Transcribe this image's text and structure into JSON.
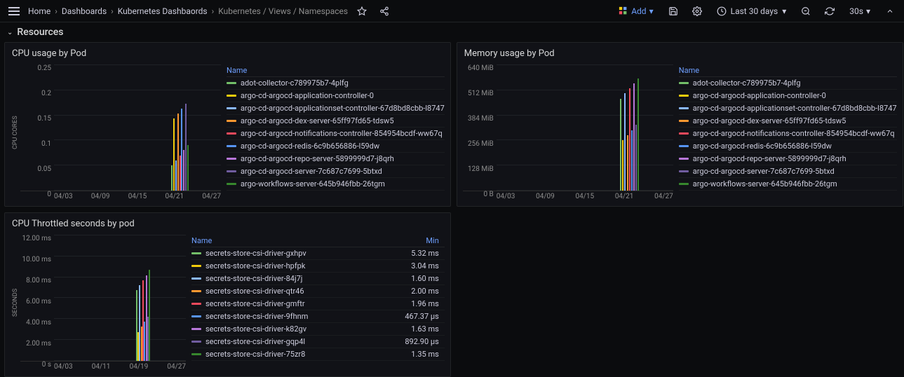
{
  "topbar": {
    "breadcrumbs": [
      "Home",
      "Dashboards",
      "Kubernetes Dashbaords",
      "Kubernetes / Views / Namespaces"
    ],
    "add_label": "Add",
    "range_label": "Last 30 days",
    "refresh_interval": "30s"
  },
  "section": {
    "title": "Resources"
  },
  "legend_labels": {
    "name": "Name",
    "min": "Min"
  },
  "colors": {
    "series": [
      "#73bf69",
      "#f2cc0c",
      "#8ab8ff",
      "#ff9830",
      "#f2495c",
      "#5794f2",
      "#b877d9",
      "#705da0",
      "#37872d",
      "#c15c17",
      "#890f02",
      "#0a437c",
      "#6d1f62",
      "#e0b400",
      "#1f78c1",
      "#ba43a9",
      "#705da0"
    ]
  },
  "panels": [
    {
      "id": "cpu-usage",
      "title": "CPU usage by Pod",
      "ylabel": "CPU CORES",
      "has_min": false,
      "chart_data": {
        "type": "line",
        "x_categories": [
          "04/03",
          "04/09",
          "04/15",
          "04/21",
          "04/27"
        ],
        "y_ticks": [
          "0",
          "0.05",
          "0.1",
          "0.15",
          "0.2",
          "0.25"
        ],
        "ylim": [
          0,
          0.27
        ],
        "spike_region": {
          "x_pct_start": 70,
          "x_pct_end": 80
        },
        "series": [
          {
            "name": "adot-collector-c789975b7-4plfg"
          },
          {
            "name": "argo-cd-argocd-application-controller-0"
          },
          {
            "name": "argo-cd-argocd-applicationset-controller-67d8bd8cbb-l8747"
          },
          {
            "name": "argo-cd-argocd-dex-server-65ff97fd65-tdsw5"
          },
          {
            "name": "argo-cd-argocd-notifications-controller-854954bcdf-ww67q"
          },
          {
            "name": "argo-cd-argocd-redis-6c9b656886-l59dw"
          },
          {
            "name": "argo-cd-argocd-repo-server-5899999d7-j8qrh"
          },
          {
            "name": "argo-cd-argocd-server-7c687c7699-5btxd"
          },
          {
            "name": "argo-workflows-server-645b946fbb-26tgm"
          }
        ]
      }
    },
    {
      "id": "memory-usage",
      "title": "Memory usage by Pod",
      "ylabel": "",
      "has_min": false,
      "chart_data": {
        "type": "line",
        "x_categories": [
          "04/03",
          "04/09",
          "04/15",
          "04/21",
          "04/27"
        ],
        "y_ticks": [
          "0 B",
          "128 MiB",
          "256 MiB",
          "384 MiB",
          "512 MiB",
          "640 MiB"
        ],
        "ylim": [
          0,
          640
        ],
        "spike_region": {
          "x_pct_start": 70,
          "x_pct_end": 80
        },
        "series": [
          {
            "name": "adot-collector-c789975b7-4plfg"
          },
          {
            "name": "argo-cd-argocd-application-controller-0"
          },
          {
            "name": "argo-cd-argocd-applicationset-controller-67d8bd8cbb-l8747"
          },
          {
            "name": "argo-cd-argocd-dex-server-65ff97fd65-tdsw5"
          },
          {
            "name": "argo-cd-argocd-notifications-controller-854954bcdf-ww67q"
          },
          {
            "name": "argo-cd-argocd-redis-6c9b656886-l59dw"
          },
          {
            "name": "argo-cd-argocd-repo-server-5899999d7-j8qrh"
          },
          {
            "name": "argo-cd-argocd-server-7c687c7699-5btxd"
          },
          {
            "name": "argo-workflows-server-645b946fbb-26tgm"
          }
        ]
      }
    },
    {
      "id": "cpu-throttled",
      "title": "CPU Throttled seconds by pod",
      "ylabel": "SECONDS",
      "has_min": true,
      "chart_data": {
        "type": "line",
        "x_categories": [
          "04/03",
          "04/11",
          "04/19",
          "04/27"
        ],
        "y_ticks": [
          "0 s",
          "2.00 ms",
          "4.00 ms",
          "6.00 ms",
          "8.00 ms",
          "10.00 ms",
          "12.00 ms"
        ],
        "ylim": [
          0,
          12
        ],
        "spike_region": {
          "x_pct_start": 62,
          "x_pct_end": 72
        },
        "series": [
          {
            "name": "secrets-store-csi-driver-gxhpv",
            "min": "5.32 ms"
          },
          {
            "name": "secrets-store-csi-driver-hpfpk",
            "min": "3.04 ms"
          },
          {
            "name": "secrets-store-csi-driver-84j7j",
            "min": "1.60 ms"
          },
          {
            "name": "secrets-store-csi-driver-qtr46",
            "min": "2.00 ms"
          },
          {
            "name": "secrets-store-csi-driver-gmftr",
            "min": "1.96 ms"
          },
          {
            "name": "secrets-store-csi-driver-9fhnm",
            "min": "467.37 µs"
          },
          {
            "name": "secrets-store-csi-driver-k82gv",
            "min": "1.63 ms"
          },
          {
            "name": "secrets-store-csi-driver-gqp4l",
            "min": "892.90 µs"
          },
          {
            "name": "secrets-store-csi-driver-75zr8",
            "min": "1.35 ms"
          }
        ]
      }
    }
  ]
}
